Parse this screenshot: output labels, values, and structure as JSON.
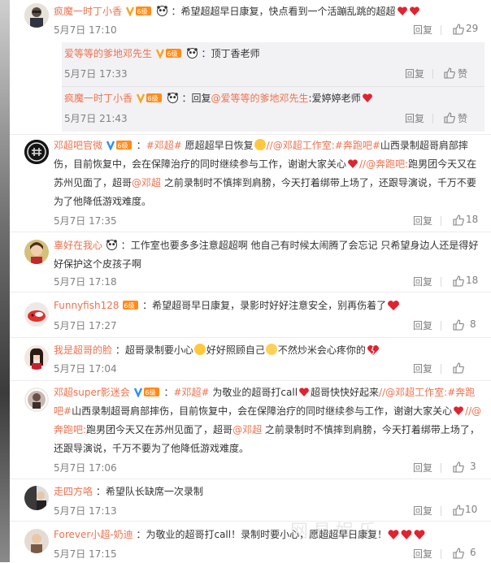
{
  "comments": [
    {
      "user": "疯魔一时丁小香",
      "colon": "：",
      "text": "希望超超早日康复，快点看到一个活蹦乱跳的超超",
      "time": "5月7日 17:10",
      "reply": "回复",
      "likes": "29"
    },
    {
      "user": "邓超吧官微",
      "colon": "：",
      "p1": "#邓超#",
      "t1": " 愿超超早日恢复",
      "p2": "//@邓超工作室:",
      "p3": "#奔跑吧#",
      "t2": "山西录制超哥肩部摔伤，目前恢复中，会在保障治疗的同时继续参与工作，谢谢大家关心",
      "p4": "//@奔跑吧:",
      "t3": "跑男团今天又在苏州见面了，超哥",
      "p5": "@邓超",
      "t4": " 之前录制时不慎摔到肩膀，今天打着绑带上场了，还跟导演说，千万不要为了他降低游戏难度。",
      "time": "5月7日 17:35",
      "reply": "回复",
      "likes": "18"
    },
    {
      "user": "辜好在我心",
      "colon": "：",
      "text": "工作室也要多多注意超超啊 他自己有时候太闹腾了会忘记 只希望身边人还是得好好保护这个皮孩子啊",
      "time": "5月7日 17:18",
      "reply": "回复",
      "likes": "18"
    },
    {
      "user": "Funnyfish128",
      "colon": "：",
      "text": "希望超哥早日康复，录影时好好注意安全，别再伤着了",
      "time": "5月7日 17:27",
      "reply": "回复",
      "likes": "8"
    },
    {
      "user": "我是超哥的脸",
      "colon": "：",
      "t1": "超哥录制要小心",
      "t2": "好好照顾自己",
      "t3": "不然炒米会心疼你的",
      "time": "5月7日 17:04",
      "reply": "回复",
      "likes": ""
    },
    {
      "user": "邓超super影迷会",
      "colon": "：",
      "p1": "#邓超#",
      "t1": " 为敬业的超哥打call",
      "t2": "超哥快快好起来",
      "p2": "//@邓超工作室:",
      "p3": "#奔跑吧#",
      "t3": "山西录制超哥肩部摔伤，目前恢复中，会在保障治疗的同时继续参与工作，谢谢大家关心",
      "p4": "//@奔跑吧:",
      "t4": "跑男团今天又在苏州见面了，超哥",
      "p5": "@邓超",
      "t5": " 之前录制时不慎摔到肩膀，今天打着绑带上场了，还跟导演说，千万不要为了他降低游戏难度。",
      "time": "5月7日 17:06",
      "reply": "回复",
      "likes": "3"
    },
    {
      "user": "走四方咯",
      "colon": "：",
      "text": "希望队长缺席一次录制",
      "time": "5月7日 17:13",
      "reply": "回复",
      "likes": "10"
    },
    {
      "user": "Forever小超-奶迪",
      "colon": "：",
      "text": "为敬业的超哥打call！录制时要小心，愿超超早日康复！",
      "time": "5月7日 17:15",
      "reply": "回复",
      "likes": "6"
    }
  ],
  "replies": [
    {
      "user": "爱等等的爹地邓先生",
      "colon": "：",
      "text": "顶丁香老师",
      "time": "5月7日 17:33",
      "reply": "回复",
      "like": "赞"
    },
    {
      "user": "疯魔一时丁小香",
      "colon": "：",
      "pre": "回复",
      "mention": "@爱等等的爹地邓先生",
      "text": ":爱婷婷老师",
      "time": "5月7日 21:43",
      "reply": "回复",
      "like": "赞"
    }
  ],
  "watermark": "网易娱乐",
  "colors": {
    "accent": "#eb7350",
    "time": "#808080",
    "reply_bg": "#f2f2f5",
    "heart": "#e0242f"
  }
}
